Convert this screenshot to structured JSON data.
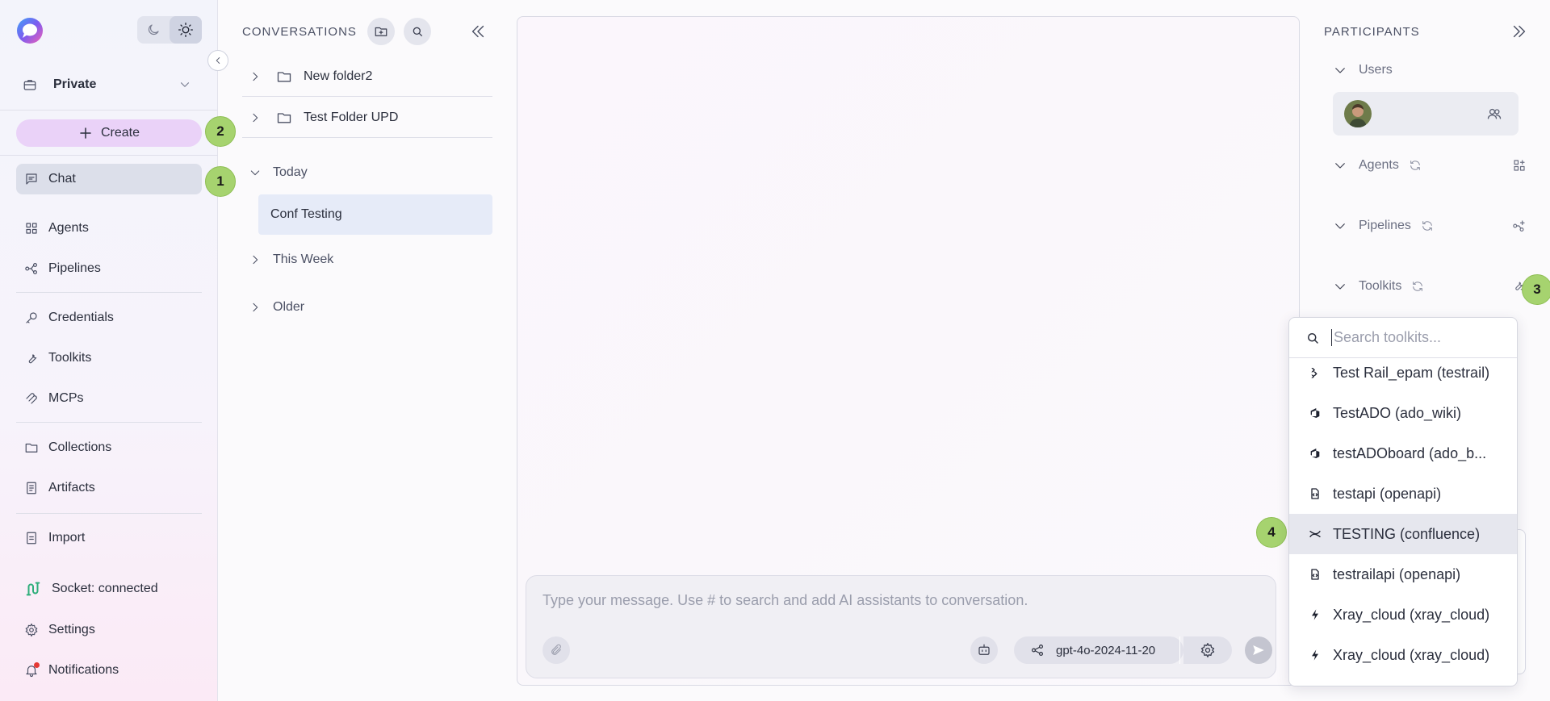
{
  "sidebar": {
    "project": "Private",
    "create_label": "Create",
    "items": [
      {
        "label": "Chat",
        "icon": "chat-icon"
      },
      {
        "label": "Agents",
        "icon": "grid-icon"
      },
      {
        "label": "Pipelines",
        "icon": "pipeline-icon"
      },
      {
        "label": "Credentials",
        "icon": "key-icon"
      },
      {
        "label": "Toolkits",
        "icon": "wrench-icon"
      },
      {
        "label": "MCPs",
        "icon": "mcp-icon"
      },
      {
        "label": "Collections",
        "icon": "folder-icon"
      },
      {
        "label": "Artifacts",
        "icon": "artifact-icon"
      },
      {
        "label": "Import",
        "icon": "import-icon"
      }
    ],
    "socket_status": "Socket: connected",
    "settings": "Settings",
    "notifications": "Notifications"
  },
  "badges": [
    "1",
    "2",
    "3",
    "4"
  ],
  "conversations": {
    "title": "CONVERSATIONS",
    "folders": [
      "New folder2",
      "Test Folder UPD"
    ],
    "groups": [
      {
        "label": "Today",
        "items": [
          "Conf Testing"
        ]
      },
      {
        "label": "This Week"
      },
      {
        "label": "Older"
      }
    ]
  },
  "chat": {
    "placeholder": "Type your message. Use # to search and add AI assistants to conversation.",
    "model": "gpt-4o-2024-11-20"
  },
  "participants": {
    "title": "PARTICIPANTS",
    "sections": [
      "Users",
      "Agents",
      "Pipelines",
      "Toolkits"
    ]
  },
  "toolkit_dropdown": {
    "placeholder": "Search toolkits...",
    "items": [
      {
        "label": "Test Rail_epam (testrail)",
        "icon": "testrail-icon"
      },
      {
        "label": "TestADO (ado_wiki)",
        "icon": "ado-icon"
      },
      {
        "label": "testADOboard (ado_b...",
        "icon": "ado-icon"
      },
      {
        "label": "testapi (openapi)",
        "icon": "openapi-icon"
      },
      {
        "label": "TESTING (confluence)",
        "icon": "confluence-icon"
      },
      {
        "label": "testrailapi (openapi)",
        "icon": "openapi-icon"
      },
      {
        "label": "Xray_cloud (xray_cloud)",
        "icon": "xray-icon"
      },
      {
        "label": "Xray_cloud (xray_cloud)",
        "icon": "xray-icon"
      }
    ]
  },
  "colors": {
    "accent": "#ead2f8",
    "badge": "#a6d36f",
    "socket_connected": "#2fae7b",
    "notification_dot": "#e53935"
  }
}
